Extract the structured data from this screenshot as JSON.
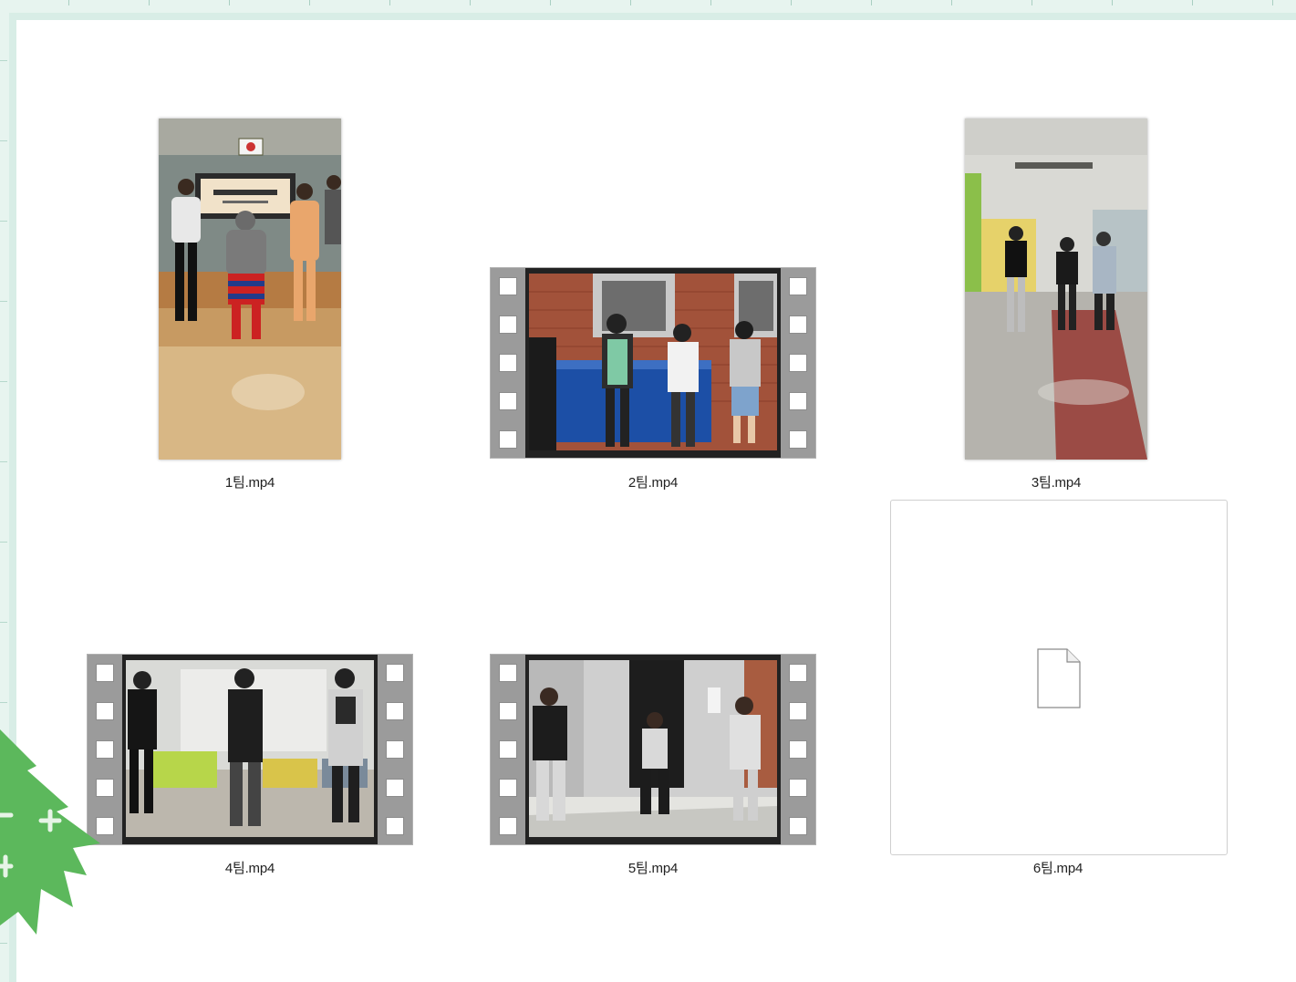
{
  "files": [
    {
      "name": "1팀.mp4",
      "kind": "portrait"
    },
    {
      "name": "2팀.mp4",
      "kind": "film"
    },
    {
      "name": "3팀.mp4",
      "kind": "portrait"
    },
    {
      "name": "4팀.mp4",
      "kind": "film"
    },
    {
      "name": "5팀.mp4",
      "kind": "film"
    },
    {
      "name": "6팀.mp4",
      "kind": "blank"
    }
  ],
  "icons": {
    "generic_file": "file-icon",
    "decoration": "tree-decoration"
  },
  "colors": {
    "frame_border": "#d8ede6",
    "background": "#ffffff",
    "tree_green": "#5cb85c",
    "caption_text": "#222222"
  }
}
